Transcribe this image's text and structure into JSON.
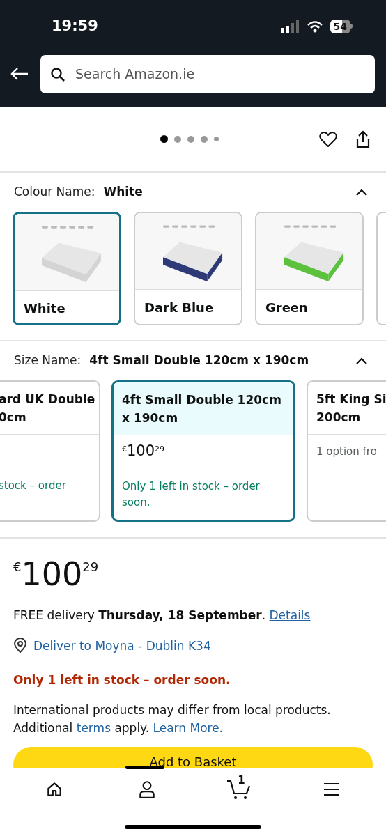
{
  "status_bar": {
    "time": "19:59",
    "battery": "54"
  },
  "search": {
    "placeholder": "Search Amazon.ie"
  },
  "carousel": {
    "dots": [
      {
        "selected": true
      },
      {
        "selected": false
      },
      {
        "selected": false
      },
      {
        "selected": false
      },
      {
        "selected": false
      }
    ]
  },
  "colour": {
    "label": "Colour Name:",
    "value": "White",
    "expanded": true,
    "options": [
      {
        "name": "White",
        "selected": true,
        "color": "#d4d4d4"
      },
      {
        "name": "Dark Blue",
        "selected": false,
        "color": "#2e3a78"
      },
      {
        "name": "Green",
        "selected": false,
        "color": "#5cc23e"
      }
    ]
  },
  "size": {
    "label": "Size Name:",
    "value": "4ft Small Double 120cm x 190cm",
    "expanded": true,
    "options": [
      {
        "title": [
          "ard UK Double",
          "0cm"
        ],
        "stock": "stock – order",
        "selected": false
      },
      {
        "title": [
          "4ft Small Double 120cm",
          "x 190cm"
        ],
        "price": {
          "currency": "€",
          "whole": "100",
          "fraction": "29"
        },
        "stock": "Only 1 left in stock – order soon.",
        "selected": true
      },
      {
        "title": [
          "5ft King Si",
          "200cm"
        ],
        "note": "1 option fro",
        "selected": false
      }
    ]
  },
  "price": {
    "currency": "€",
    "whole": "100",
    "fraction": "29"
  },
  "delivery": {
    "text": "FREE delivery **Thursday, 18 September**.",
    "link": "Details"
  },
  "deliver_to": "Deliver to Moyna - Dublin K34",
  "stock": "Only 1 left in stock – order soon.",
  "notice": {
    "text1": "International products may differ from local products. Additional",
    "link1": "terms",
    "text2": "apply.",
    "link2": "Learn More."
  },
  "add_button": "Add to Basket",
  "bottom_nav": [
    {
      "kind": "home"
    },
    {
      "kind": "account"
    },
    {
      "kind": "cart",
      "badge": "1"
    },
    {
      "kind": "menu"
    }
  ]
}
